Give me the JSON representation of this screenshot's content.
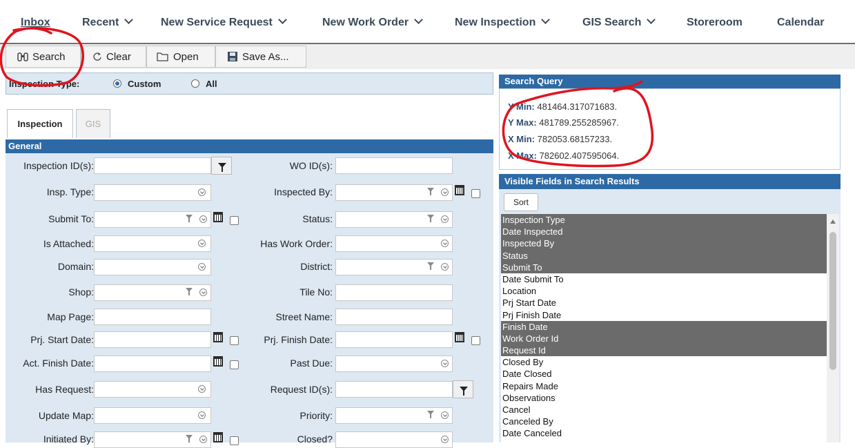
{
  "topnav": {
    "items": [
      "Inbox",
      "Recent",
      "New Service Request",
      "New Work Order",
      "New Inspection",
      "GIS Search",
      "Storeroom",
      "Calendar"
    ]
  },
  "toolbar": {
    "search": "Search",
    "clear": "Clear",
    "open": "Open",
    "save_as": "Save As..."
  },
  "inspection_type": {
    "label": "Inspection Type:",
    "custom": "Custom",
    "all": "All",
    "selected": "Custom"
  },
  "tabs": [
    "Inspection",
    "GIS"
  ],
  "section_general": "General",
  "form": {
    "inspection_ids": "Inspection ID(s):",
    "wo_ids": "WO ID(s):",
    "insp_type": "Insp. Type:",
    "inspected_by": "Inspected By:",
    "submit_to": "Submit To:",
    "status": "Status:",
    "is_attached": "Is Attached:",
    "has_work_order": "Has Work Order:",
    "domain": "Domain:",
    "district": "District:",
    "shop": "Shop:",
    "tile_no": "Tile No:",
    "map_page": "Map Page:",
    "street_name": "Street Name:",
    "prj_start": "Prj. Start Date:",
    "prj_finish": "Prj. Finish Date:",
    "act_finish": "Act. Finish Date:",
    "past_due": "Past Due:",
    "has_request": "Has Request:",
    "request_ids": "Request ID(s):",
    "update_map": "Update Map:",
    "priority": "Priority:",
    "initiated_by": "Initiated By:",
    "closed": "Closed?"
  },
  "search_query": {
    "title": "Search Query",
    "lines": [
      {
        "label": "Y Min:",
        "value": "481464.317071683."
      },
      {
        "label": "Y Max:",
        "value": "481789.255285967."
      },
      {
        "label": "X Min:",
        "value": "782053.68157233."
      },
      {
        "label": "X Max:",
        "value": "782602.407595064."
      }
    ]
  },
  "visible_fields": {
    "title": "Visible Fields in Search Results",
    "sort": "Sort",
    "items": [
      {
        "label": "Inspection Type",
        "selected": true
      },
      {
        "label": "Date Inspected",
        "selected": true
      },
      {
        "label": "Inspected By",
        "selected": true
      },
      {
        "label": "Status",
        "selected": true
      },
      {
        "label": "Submit To",
        "selected": true
      },
      {
        "label": "Date Submit To",
        "selected": false
      },
      {
        "label": "Location",
        "selected": false
      },
      {
        "label": "Prj Start Date",
        "selected": false
      },
      {
        "label": "Prj Finish Date",
        "selected": false
      },
      {
        "label": "Finish Date",
        "selected": true
      },
      {
        "label": "Work Order Id",
        "selected": true
      },
      {
        "label": "Request Id",
        "selected": true
      },
      {
        "label": "Closed By",
        "selected": false
      },
      {
        "label": "Date Closed",
        "selected": false
      },
      {
        "label": "Repairs Made",
        "selected": false
      },
      {
        "label": "Observations",
        "selected": false
      },
      {
        "label": "Cancel",
        "selected": false
      },
      {
        "label": "Canceled By",
        "selected": false
      },
      {
        "label": "Date Canceled",
        "selected": false
      }
    ]
  },
  "colors": {
    "header_blue": "#2d6aa5",
    "panel_bg": "#dde8f3",
    "selected_row": "#6b6b6b",
    "annotation_red": "#e0141e"
  }
}
